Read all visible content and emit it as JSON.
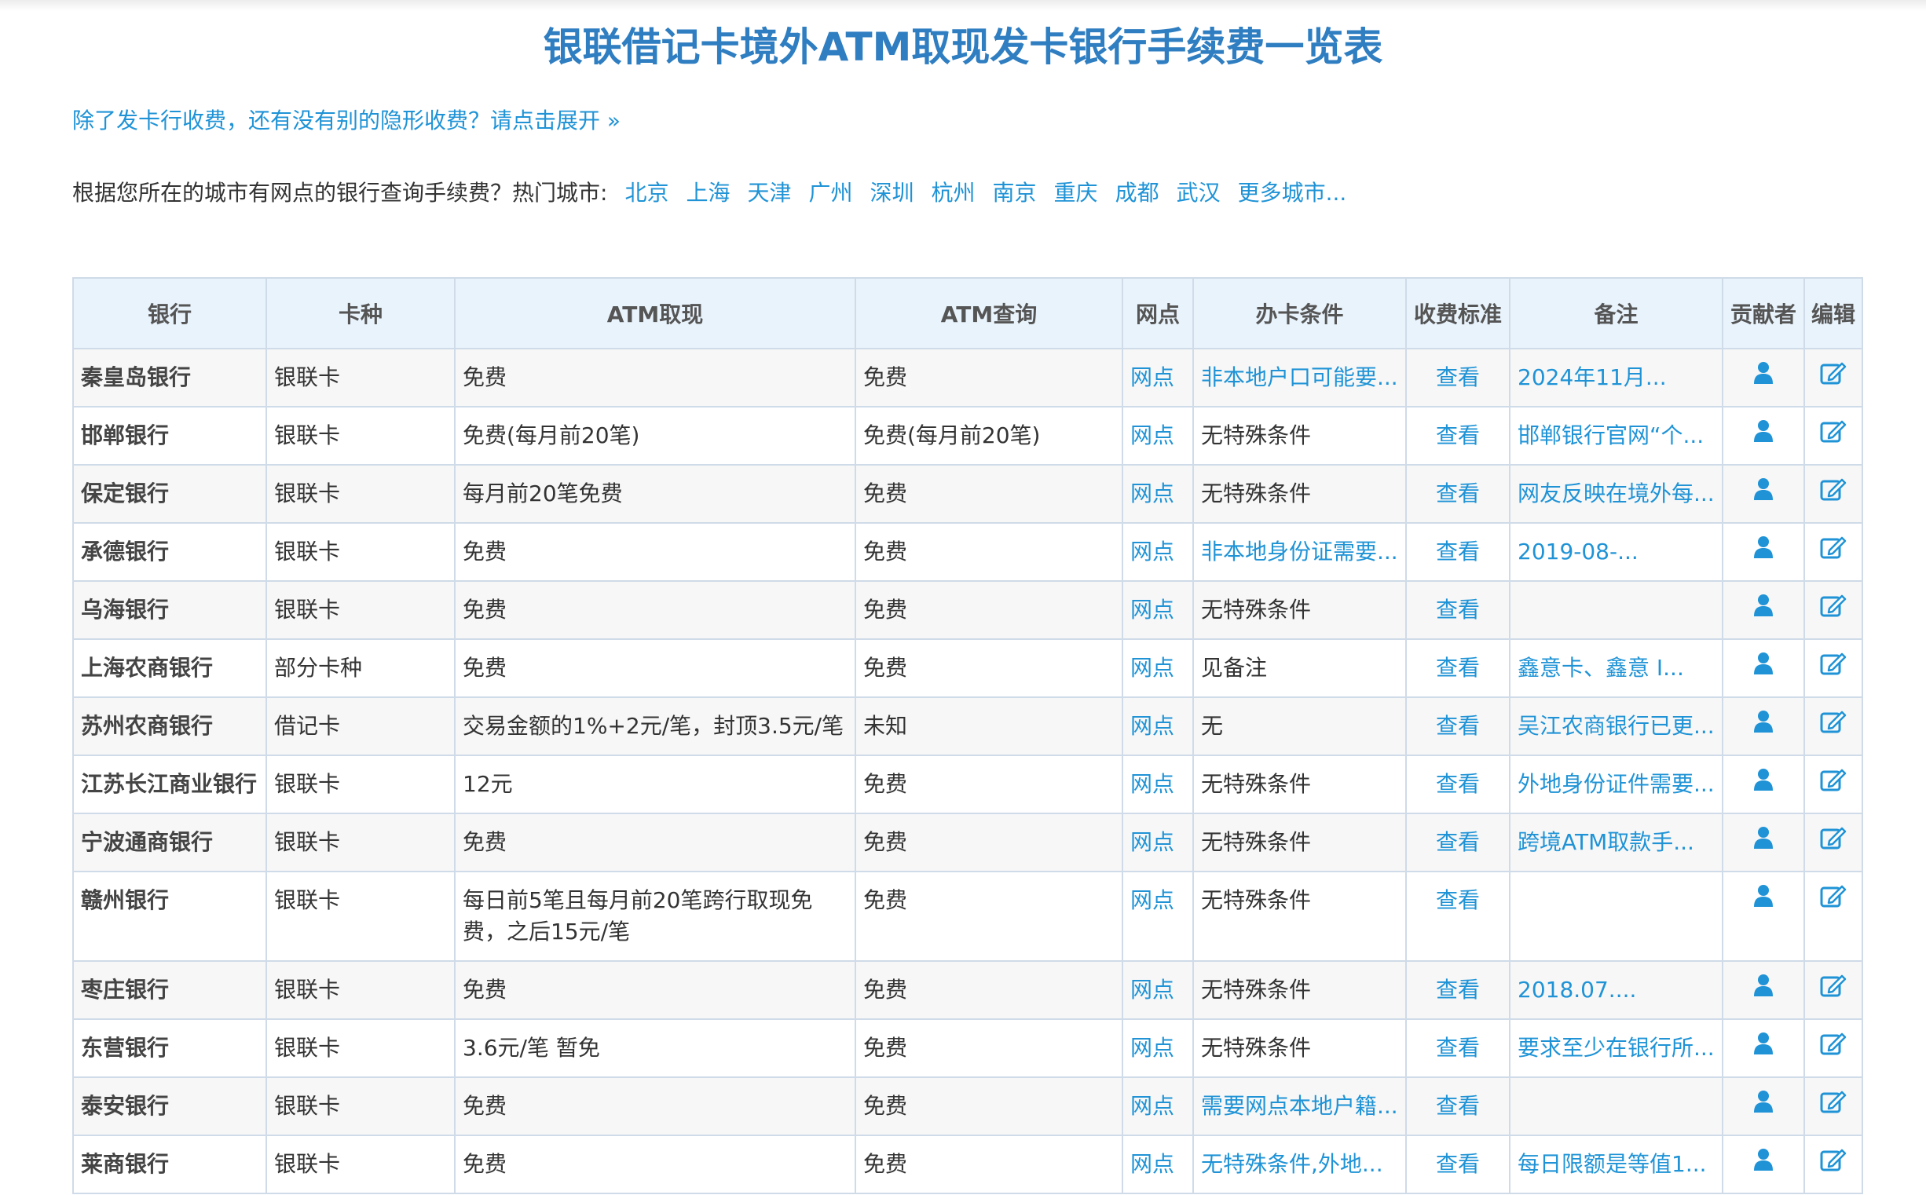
{
  "page": {
    "title": "银联借记卡境外ATM取现发卡银行手续费一览表",
    "notice_link": "除了发卡行收费，还有没有别的隐形收费？请点击展开 »",
    "city_prompt": "根据您所在的城市有网点的银行查询手续费？热门城市:",
    "cities": [
      "北京",
      "上海",
      "天津",
      "广州",
      "深圳",
      "杭州",
      "南京",
      "重庆",
      "成都",
      "武汉",
      "更多城市..."
    ]
  },
  "table": {
    "headers": [
      "银行",
      "卡种",
      "ATM取现",
      "ATM查询",
      "网点",
      "办卡条件",
      "收费标准",
      "备注",
      "贡献者",
      "编辑"
    ],
    "colors": {
      "link": "#1f93d6",
      "title": "#2f7ec1",
      "header_bg": "#e9f3fc",
      "border": "#cfdbe8"
    },
    "rows": [
      {
        "bank": "秦皇岛银行",
        "card": "银联卡",
        "withdraw": "免费",
        "query": "免费",
        "branch": "网点",
        "condition": "非本地户口可能要...",
        "condition_link": true,
        "fee": "查看",
        "note": "2024年11月..."
      },
      {
        "bank": "邯郸银行",
        "card": "银联卡",
        "withdraw": "免费(每月前20笔)",
        "query": "免费(每月前20笔)",
        "branch": "网点",
        "condition": "无特殊条件",
        "condition_link": false,
        "fee": "查看",
        "note": "邯郸银行官网“个..."
      },
      {
        "bank": "保定银行",
        "card": "银联卡",
        "withdraw": "每月前20笔免费",
        "query": "免费",
        "branch": "网点",
        "condition": "无特殊条件",
        "condition_link": false,
        "fee": "查看",
        "note": "网友反映在境外每..."
      },
      {
        "bank": "承德银行",
        "card": "银联卡",
        "withdraw": "免费",
        "query": "免费",
        "branch": "网点",
        "condition": "非本地身份证需要...",
        "condition_link": true,
        "fee": "查看",
        "note": "2019-08-..."
      },
      {
        "bank": "乌海银行",
        "card": "银联卡",
        "withdraw": "免费",
        "query": "免费",
        "branch": "网点",
        "condition": "无特殊条件",
        "condition_link": false,
        "fee": "查看",
        "note": ""
      },
      {
        "bank": "上海农商银行",
        "card": "部分卡种",
        "withdraw": "免费",
        "query": "免费",
        "branch": "网点",
        "condition": "见备注",
        "condition_link": false,
        "fee": "查看",
        "note": "鑫意卡、鑫意 I..."
      },
      {
        "bank": "苏州农商银行",
        "card": "借记卡",
        "withdraw": "交易金额的1%+2元/笔，封顶3.5元/笔",
        "query": "未知",
        "branch": "网点",
        "condition": "无",
        "condition_link": false,
        "fee": "查看",
        "note": "吴江农商银行已更..."
      },
      {
        "bank": "江苏长江商业银行",
        "card": "银联卡",
        "withdraw": "12元",
        "query": "免费",
        "branch": "网点",
        "condition": "无特殊条件",
        "condition_link": false,
        "fee": "查看",
        "note": "外地身份证件需要..."
      },
      {
        "bank": "宁波通商银行",
        "card": "银联卡",
        "withdraw": "免费",
        "query": "免费",
        "branch": "网点",
        "condition": "无特殊条件",
        "condition_link": false,
        "fee": "查看",
        "note": "跨境ATM取款手..."
      },
      {
        "bank": "赣州银行",
        "card": "银联卡",
        "withdraw": "每日前5笔且每月前20笔跨行取现免费，之后15元/笔",
        "query": "免费",
        "branch": "网点",
        "condition": "无特殊条件",
        "condition_link": false,
        "fee": "查看",
        "note": ""
      },
      {
        "bank": "枣庄银行",
        "card": "银联卡",
        "withdraw": "免费",
        "query": "免费",
        "branch": "网点",
        "condition": "无特殊条件",
        "condition_link": false,
        "fee": "查看",
        "note": "2018.07...."
      },
      {
        "bank": "东营银行",
        "card": "银联卡",
        "withdraw": "3.6元/笔 暂免",
        "query": "免费",
        "branch": "网点",
        "condition": "无特殊条件",
        "condition_link": false,
        "fee": "查看",
        "note": "要求至少在银行所..."
      },
      {
        "bank": "泰安银行",
        "card": "银联卡",
        "withdraw": "免费",
        "query": "免费",
        "branch": "网点",
        "condition": "需要网点本地户籍...",
        "condition_link": true,
        "fee": "查看",
        "note": ""
      },
      {
        "bank": "莱商银行",
        "card": "银联卡",
        "withdraw": "免费",
        "query": "免费",
        "branch": "网点",
        "condition": "无特殊条件,外地...",
        "condition_link": true,
        "fee": "查看",
        "note": "每日限额是等值1..."
      }
    ],
    "icons": {
      "contributor": "user-icon",
      "edit": "edit-icon"
    }
  }
}
